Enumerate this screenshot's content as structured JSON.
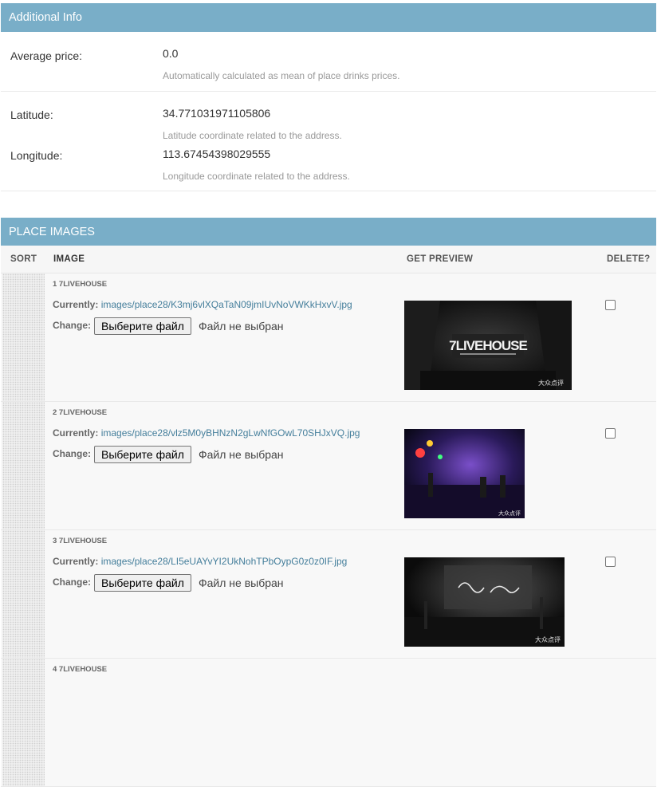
{
  "additional_info": {
    "header": "Additional Info",
    "fields": [
      {
        "label": "Average price:",
        "value": "0.0",
        "help": "Automatically calculated as mean of place drinks prices."
      },
      {
        "label": "Latitude:",
        "value": "34.771031971105806",
        "help": "Latitude coordinate related to the address."
      },
      {
        "label": "Longitude:",
        "value": "113.67454398029555",
        "help": "Longitude coordinate related to the address."
      }
    ]
  },
  "place_images": {
    "header": "PLACE IMAGES",
    "columns": {
      "sort": "SORT",
      "image": "IMAGE",
      "preview": "GET PREVIEW",
      "delete": "DELETE?"
    },
    "currently_label": "Currently:",
    "change_label": "Change:",
    "file_button": "Выберите файл",
    "no_file": "Файл не выбран",
    "rows": [
      {
        "title": "1 7LIVEHOUSE",
        "path": "images/place28/K3mj6vlXQaTaN09jmIUvNoVWKkHxvV.jpg",
        "preview_text": "7LIVEHOUSE",
        "watermark": "大众点评",
        "delete_checked": false
      },
      {
        "title": "2 7LIVEHOUSE",
        "path": "images/place28/vlz5M0yBHNzN2gLwNfGOwL70SHJxVQ.jpg",
        "preview_text": "",
        "watermark": "大众点评",
        "delete_checked": false
      },
      {
        "title": "3 7LIVEHOUSE",
        "path": "images/place28/LI5eUAYvYI2UkNohTPbOypG0z0z0IF.jpg",
        "preview_text": "",
        "watermark": "大众点评",
        "delete_checked": false
      },
      {
        "title": "4 7LIVEHOUSE"
      }
    ]
  }
}
